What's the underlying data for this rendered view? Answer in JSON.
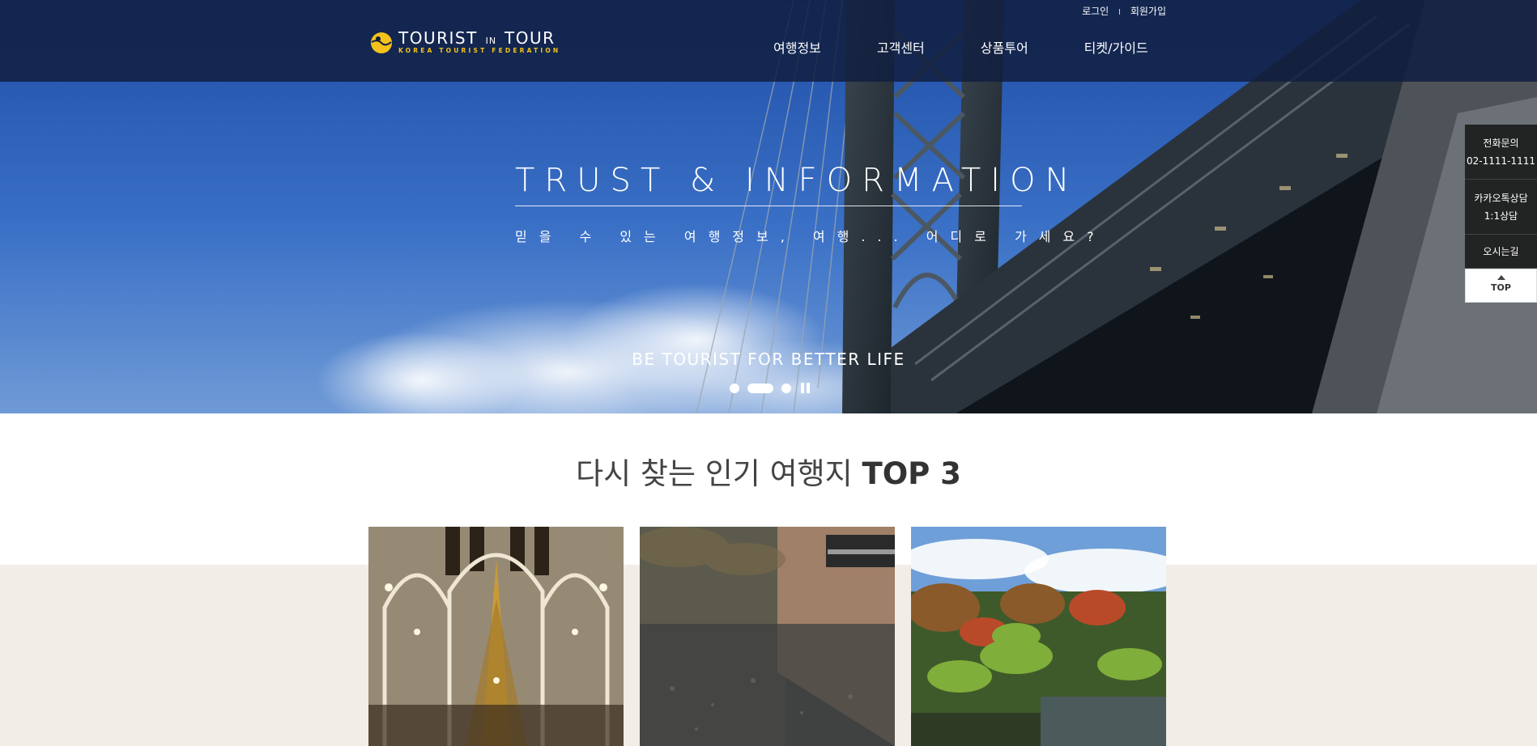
{
  "header": {
    "logo": {
      "title_main": "TOURIST",
      "title_small": "IN",
      "title_end": "TOUR",
      "subtitle": "KOREA TOURIST FEDERATION"
    },
    "util_links": {
      "login": "로그인",
      "separator": "I",
      "signup": "회원가입"
    },
    "nav": [
      "여행정보",
      "고객센터",
      "상품투어",
      "티켓/가이드"
    ]
  },
  "hero": {
    "title": "TRUST & INFORMATION",
    "subtitle": "믿을 수 있는 여행정보, 여행... 어디로 가세요?",
    "tagline": "BE TOURIST FOR BETTER LIFE",
    "pager": {
      "slides": 3,
      "active": 2,
      "control_icon": "pause-icon"
    }
  },
  "quick_menu": {
    "phone_label": "전화문의",
    "phone_number": "02-1111-1111",
    "kakao_label": "카카오톡상담",
    "kakao_sub": "1:1상담",
    "directions": "오시는길",
    "top": "TOP"
  },
  "section": {
    "title_prefix": "다시 찾는 인기 여행지 ",
    "title_bold": "TOP 3",
    "cards": [
      "cathedral-photo",
      "reflecting-pool-photo",
      "japanese-garden-photo"
    ]
  },
  "colors": {
    "header_bg": "#101e40",
    "accent_yellow": "#f3c21b",
    "beige": "#f2ede6",
    "sky": "#2d63b5"
  }
}
